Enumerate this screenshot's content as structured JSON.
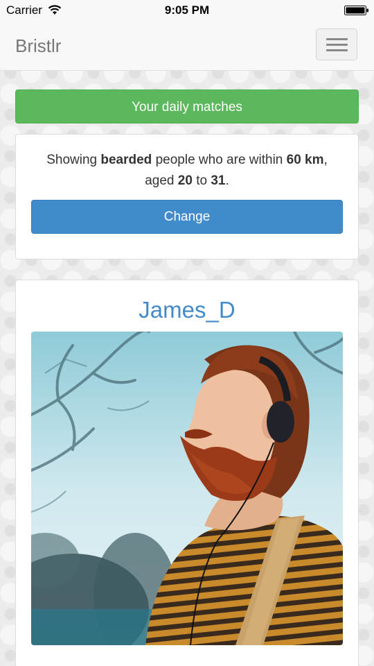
{
  "status_bar": {
    "carrier": "Carrier",
    "time": "9:05 PM"
  },
  "navbar": {
    "brand": "Bristlr"
  },
  "banner": {
    "text": "Your daily matches"
  },
  "filter": {
    "prefix": "Showing ",
    "trait": "bearded",
    "middle": " people who are within ",
    "distance": "60 km",
    "sep": ",",
    "aged": "aged ",
    "age_min": "20",
    "to": " to ",
    "age_max": "31",
    "end": ".",
    "change_label": "Change"
  },
  "profile": {
    "name": "James_D"
  },
  "colors": {
    "success": "#5cb85c",
    "primary": "#428bca",
    "brand_text": "#777777"
  },
  "icons": {
    "wifi": "wifi-icon",
    "battery": "battery-icon",
    "menu": "hamburger-menu-icon"
  }
}
